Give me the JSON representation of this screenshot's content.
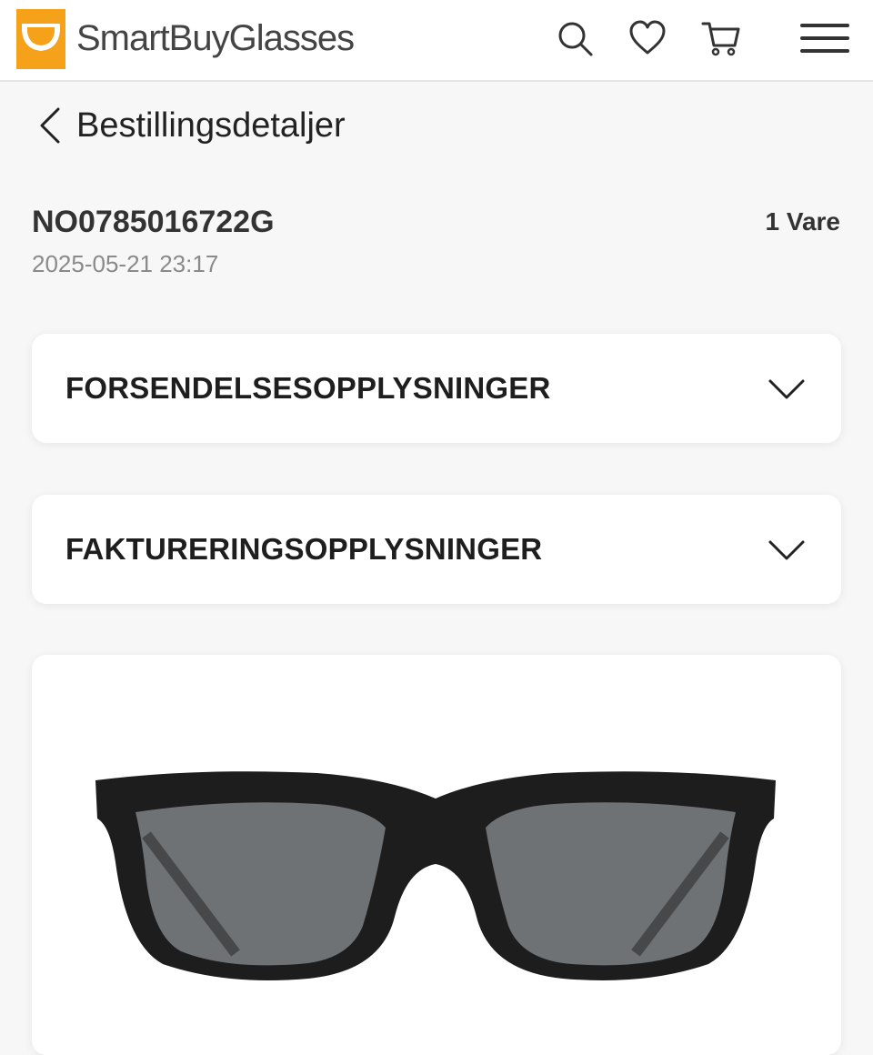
{
  "header": {
    "brand": "SmartBuyGlasses",
    "logo_color": "#F5A11A",
    "icons": [
      "search-icon",
      "heart-icon",
      "cart-icon",
      "menu-icon"
    ]
  },
  "page": {
    "back_icon": "chevron-left-icon",
    "title": "Bestillingsdetaljer"
  },
  "order": {
    "id": "NO0785016722G",
    "date": "2025-05-21 23:17",
    "item_count": "1 Vare"
  },
  "sections": [
    {
      "title": "FORSENDELSESOPPLYSNINGER",
      "icon": "chevron-down-icon"
    },
    {
      "title": "FAKTURERINGSOPPLYSNINGER",
      "icon": "chevron-down-icon"
    }
  ],
  "product": {
    "image": "sunglasses-product-image",
    "frame_color": "#1d1d1d",
    "lens_color": "#6f7275"
  }
}
